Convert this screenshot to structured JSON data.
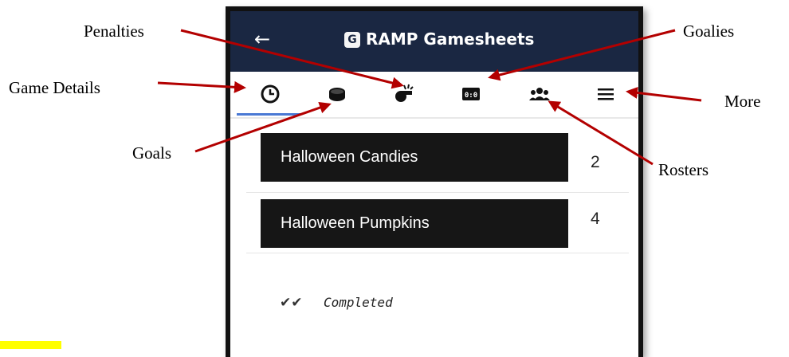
{
  "annotations": {
    "penalties": "Penalties",
    "goalies": "Goalies",
    "game_details": "Game Details",
    "more": "More",
    "goals": "Goals",
    "rosters": "Rosters"
  },
  "header": {
    "back_icon": "arrow-left-icon",
    "logo_letter": "G",
    "title": "RAMP Gamesheets",
    "background": "#1a2742"
  },
  "tabs": [
    {
      "name": "game-details",
      "icon": "clock-icon",
      "active": true
    },
    {
      "name": "goals",
      "icon": "puck-icon"
    },
    {
      "name": "penalties",
      "icon": "whistle-icon"
    },
    {
      "name": "goalies",
      "icon": "scoreboard-icon"
    },
    {
      "name": "rosters",
      "icon": "people-icon"
    },
    {
      "name": "more",
      "icon": "hamburger-menu-icon"
    }
  ],
  "teams": [
    {
      "name": "Halloween Candies",
      "score": "2"
    },
    {
      "name": "Halloween Pumpkins",
      "score": "4"
    }
  ],
  "status": {
    "icon": "double-check-icon",
    "label": "Completed"
  },
  "colors": {
    "accent": "#4a79d4",
    "arrow": "#b30000",
    "highlight": "#ffff00"
  }
}
